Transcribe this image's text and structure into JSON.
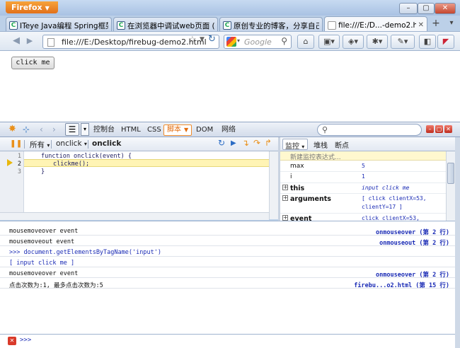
{
  "window": {
    "app_button": "Firefox",
    "controls": {
      "minimize": "–",
      "maximize": "▢",
      "close": "✕"
    }
  },
  "tabs": [
    {
      "title": "ITeye Java编程 Spring框架 ...",
      "active": false
    },
    {
      "title": "在浏览器中调试web页面 ( ...",
      "active": false
    },
    {
      "title": "原创专业的博客，分享自己...",
      "active": false
    },
    {
      "title": "file:///E:/D...-demo2.html",
      "active": true
    }
  ],
  "tabbar": {
    "new_tab": "+",
    "list": "▾"
  },
  "navbar": {
    "url": "file:///E:/Desktop/firebug-demo2.html",
    "search_placeholder": "Google",
    "back": "◀",
    "forward": "▶"
  },
  "page": {
    "button_label": "click me"
  },
  "firebug": {
    "tabs": [
      "控制台",
      "HTML",
      "CSS",
      "脚本",
      "DOM",
      "网络"
    ],
    "active_tab": "脚本",
    "script_bar": {
      "all_label": "所有",
      "file_label": "onclick",
      "function_label": "onclick"
    },
    "watch_tabs": [
      "监控",
      "堆栈",
      "断点"
    ],
    "code_lines": [
      {
        "num": "1",
        "text": "function onclick(event) {"
      },
      {
        "num": "2",
        "text": "clickme();"
      },
      {
        "num": "3",
        "text": "}"
      }
    ],
    "watch": {
      "new_expression": "新建监控表达式...",
      "rows": [
        {
          "name": "max",
          "value": "5",
          "expandable": false,
          "bold": false
        },
        {
          "name": "i",
          "value": "1",
          "expandable": false,
          "bold": false
        },
        {
          "name": "this",
          "value": "input click me",
          "expandable": true,
          "bold": true
        },
        {
          "name": "arguments",
          "value": "[ click clientX=53,",
          "value2": "clientY=17 ]",
          "expandable": true,
          "bold": true
        },
        {
          "name": "event",
          "value": "click clientX=53,",
          "expandable": true,
          "bold": true
        }
      ]
    },
    "console": [
      {
        "text": "mousemoveover event",
        "source": "onmouseover (第 2 行)"
      },
      {
        "text": "mousemoveout event",
        "source": "onmouseout (第 2 行)"
      },
      {
        "text": ">>> document.getElementsByTagName('input')",
        "source": ""
      },
      {
        "text": "[ input click me ]",
        "source": ""
      },
      {
        "text": "mousemoveover event",
        "source": "onmouseover (第 2 行)"
      },
      {
        "text": "点击次数为:1, 最多点击次数为:5",
        "source": "firebu...o2.html (第 15 行)"
      }
    ],
    "command_prompt": ">>>"
  }
}
